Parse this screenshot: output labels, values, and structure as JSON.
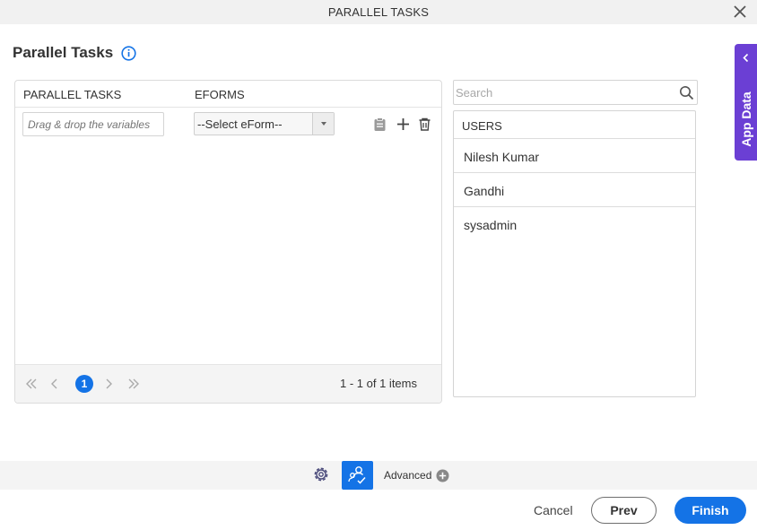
{
  "window": {
    "title": "PARALLEL TASKS"
  },
  "page": {
    "title": "Parallel Tasks"
  },
  "grid": {
    "columns": [
      "PARALLEL TASKS",
      "EFORMS"
    ],
    "row": {
      "variable_placeholder": "Drag & drop the variables",
      "eform_selected": "--Select eForm--"
    },
    "pager": {
      "current_page": "1",
      "items_info": "1 - 1 of 1 items"
    }
  },
  "search": {
    "placeholder": "Search"
  },
  "users": {
    "header": "USERS",
    "items": [
      "Nilesh Kumar",
      "Gandhi",
      "sysadmin"
    ]
  },
  "side_tab": {
    "label": "App Data"
  },
  "toolbar": {
    "advanced_label": "Advanced"
  },
  "footer": {
    "cancel_label": "Cancel",
    "prev_label": "Prev",
    "finish_label": "Finish"
  },
  "colors": {
    "accent": "#1473e6",
    "app_data_tab": "#6b3fd4"
  }
}
